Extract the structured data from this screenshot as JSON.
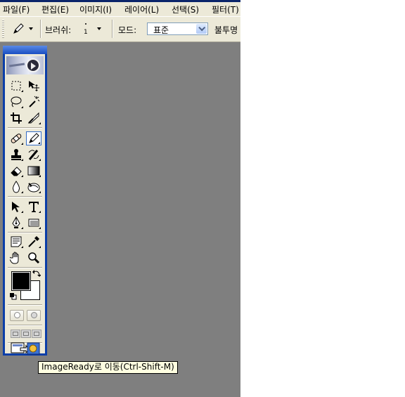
{
  "menubar": {
    "items": [
      "파일(F)",
      "편집(E)",
      "이미지(I)",
      "레이어(L)",
      "선택(S)",
      "필터(T)"
    ]
  },
  "options_bar": {
    "brush_label": "브러쉬:",
    "brush_size": "1",
    "mode_label": "모드:",
    "mode_value": "표준",
    "opacity_label": "불투명"
  },
  "tooltip": {
    "text": "ImageReady로 이동(Ctrl-Shift-M)"
  },
  "colors": {
    "foreground": "#000000",
    "background": "#ffffff",
    "workspace": "#7f7f7f",
    "toolbox_frame": "#0b3ea8"
  },
  "toolbox": {
    "tools": [
      "marquee-icon",
      "move-icon",
      "lasso-icon",
      "magic-wand-icon",
      "crop-icon",
      "slice-icon",
      "healing-brush-icon",
      "pencil-icon",
      "clone-stamp-icon",
      "history-brush-icon",
      "eraser-icon",
      "gradient-icon",
      "blur-icon",
      "dodge-icon",
      "path-selection-icon",
      "type-icon",
      "pen-icon",
      "shape-icon",
      "notes-icon",
      "eyedropper-icon",
      "hand-icon",
      "zoom-icon"
    ],
    "active_tool": "pencil-icon"
  }
}
